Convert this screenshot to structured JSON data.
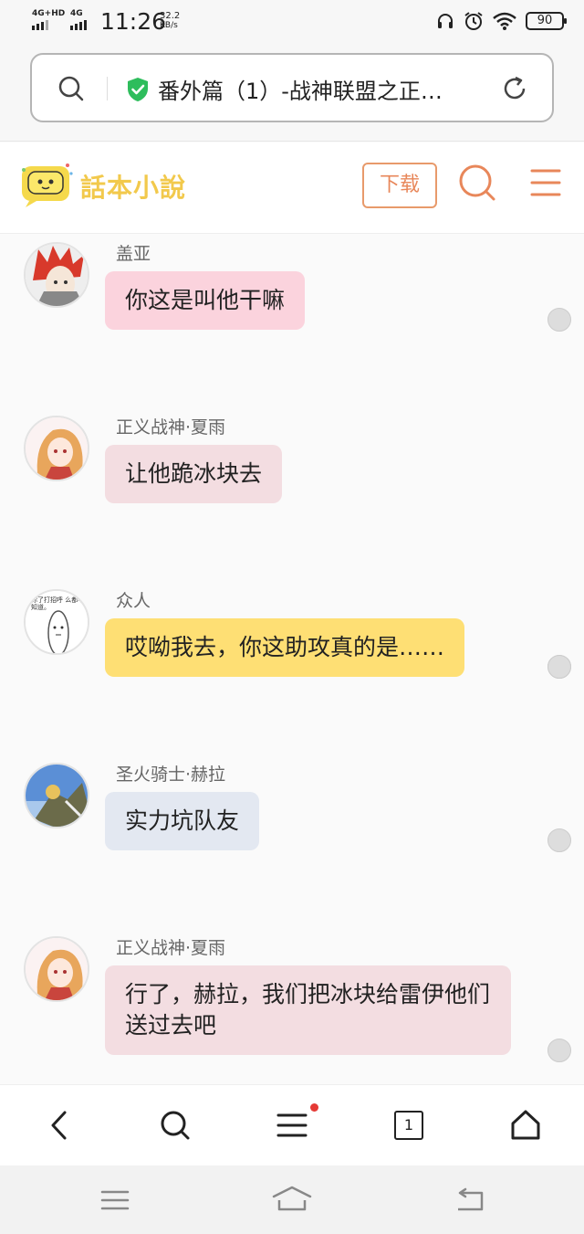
{
  "status_bar": {
    "network1": "4G+HD",
    "network2": "4G",
    "time": "11:26",
    "speed_value": "32.2",
    "speed_unit": "KB/s",
    "battery": "90",
    "icons": [
      "headphones-icon",
      "alarm-icon",
      "wifi-icon",
      "battery-icon"
    ]
  },
  "address_bar": {
    "page_title": "番外篇（1）-战神联盟之正…",
    "icons": [
      "search-icon",
      "shield-check-icon",
      "reload-icon"
    ]
  },
  "site_header": {
    "brand": "話本小說",
    "download_label": "下载",
    "icons": [
      "logo-icon",
      "search-icon",
      "menu-icon"
    ]
  },
  "chat": {
    "messages": [
      {
        "name": "盖亚",
        "text": "你这是叫他干嘛",
        "bubble_color": "#fbd3dd"
      },
      {
        "name": "正义战神·夏雨",
        "text": "让他跪冰块去",
        "bubble_color": "#f3dde1"
      },
      {
        "name": "众人",
        "text": "哎呦我去，你这助攻真的是……",
        "bubble_color": "#fedf74",
        "avatar_text": "你了打招呼 么都不知道。"
      },
      {
        "name": "圣火骑士·赫拉",
        "text": "实力坑队友",
        "bubble_color": "#e3e8f1"
      },
      {
        "name": "正义战神·夏雨",
        "text": "行了，赫拉，我们把冰块给雷伊他们送过去吧",
        "bubble_color": "#f3dde1"
      }
    ]
  },
  "bottom_nav": {
    "tab_count": "1",
    "icons": [
      "back-icon",
      "search-icon",
      "menu-icon",
      "tabs-icon",
      "home-icon"
    ]
  },
  "system_nav": {
    "icons": [
      "recents-icon",
      "home-gesture-icon",
      "back-gesture-icon"
    ]
  },
  "colors": {
    "accent": "#e8875a",
    "secure_green": "#2ebd5c",
    "brand_yellow": "#f2c94c"
  }
}
